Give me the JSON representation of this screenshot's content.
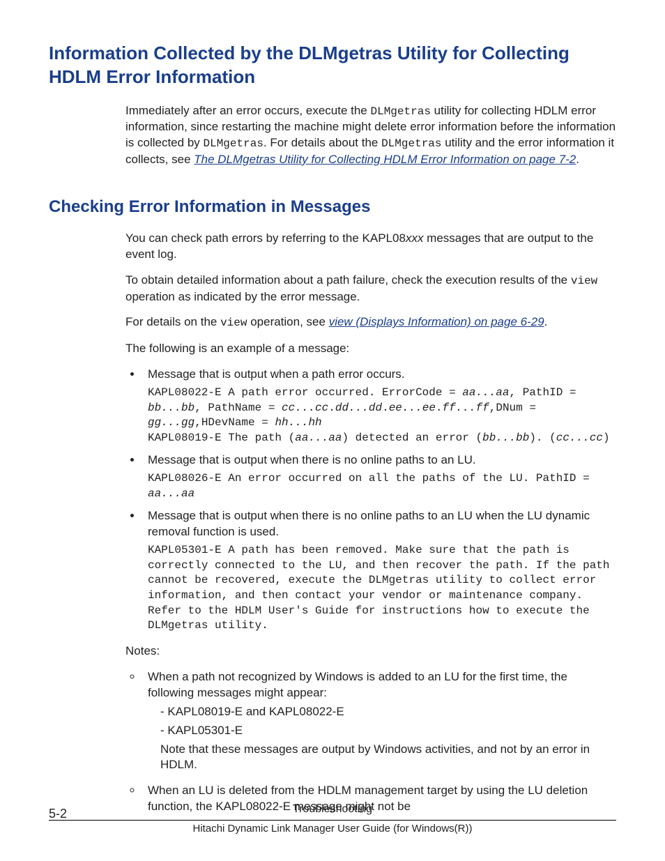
{
  "section1": {
    "heading": "Information Collected by the DLMgetras Utility for Collecting HDLM Error Information",
    "para_a": "Immediately after an error occurs, execute the ",
    "para_b": " utility for collecting HDLM error information, since restarting the machine might delete error information before the information is collected by ",
    "para_c": ". For details about the ",
    "para_d": " utility and the error information it collects, see ",
    "link": "The DLMgetras Utility for Collecting HDLM Error Information on page 7-2",
    "para_e": ".",
    "code": "DLMgetras"
  },
  "section2": {
    "heading": "Checking Error Information in Messages",
    "p1a": "You can check path errors by referring to the KAPL08",
    "p1b": "xxx",
    "p1c": " messages that are output to the event log.",
    "p2a": "To obtain detailed information about a path failure, check the execution results of the ",
    "p2b": "view",
    "p2c": " operation as indicated by the error message.",
    "p3a": "For details on the ",
    "p3b": "view",
    "p3c": " operation, see ",
    "p3link": "view (Displays Information) on page 6-29",
    "p3d": ".",
    "p4": "The following is an example of a message:",
    "items": [
      {
        "label": "Message that is output when a path error occurs.",
        "msg_parts": [
          {
            "t": "plain",
            "v": "KAPL08022-E A path error occurred. ErrorCode = "
          },
          {
            "t": "ital",
            "v": "aa...aa"
          },
          {
            "t": "plain",
            "v": ", PathID = "
          },
          {
            "t": "ital",
            "v": "bb...bb"
          },
          {
            "t": "plain",
            "v": ", PathName = "
          },
          {
            "t": "ital",
            "v": "cc...cc"
          },
          {
            "t": "plain",
            "v": "."
          },
          {
            "t": "ital",
            "v": "dd...dd"
          },
          {
            "t": "plain",
            "v": "."
          },
          {
            "t": "ital",
            "v": "ee...ee"
          },
          {
            "t": "plain",
            "v": "."
          },
          {
            "t": "ital",
            "v": "ff...ff"
          },
          {
            "t": "plain",
            "v": ",DNum = "
          },
          {
            "t": "ital",
            "v": "gg...gg"
          },
          {
            "t": "plain",
            "v": ",HDevName = "
          },
          {
            "t": "ital",
            "v": "hh...hh"
          },
          {
            "t": "br"
          },
          {
            "t": "plain",
            "v": "KAPL08019-E The path ("
          },
          {
            "t": "ital",
            "v": "aa...aa"
          },
          {
            "t": "plain",
            "v": ") detected an error ("
          },
          {
            "t": "ital",
            "v": "bb...bb"
          },
          {
            "t": "plain",
            "v": "). ("
          },
          {
            "t": "ital",
            "v": "cc...cc"
          },
          {
            "t": "plain",
            "v": ")"
          }
        ]
      },
      {
        "label": "Message that is output when there is no online paths to an LU.",
        "msg_parts": [
          {
            "t": "plain",
            "v": "KAPL08026-E An error occurred on all the paths of the LU. PathID = "
          },
          {
            "t": "ital",
            "v": "aa...aa"
          }
        ]
      },
      {
        "label": "Message that is output when there is no online paths to an LU when the LU dynamic removal function is used.",
        "msg_parts": [
          {
            "t": "plain",
            "v": "KAPL05301-E A path has been removed. Make sure that the path is correctly connected to the LU, and then recover the path. If the path cannot be recovered, execute the DLMgetras utility to collect error information, and then contact your vendor or maintenance company."
          },
          {
            "t": "br"
          },
          {
            "t": "plain",
            "v": "Refer to the HDLM User's Guide for instructions how to execute the DLMgetras utility."
          }
        ]
      }
    ],
    "notes_label": "Notes:",
    "notes": [
      {
        "text": "When a path not recognized by Windows is added to an LU for the first time, the following messages might appear:",
        "lines": [
          "- KAPL08019-E and KAPL08022-E",
          "- KAPL05301-E",
          "Note that these messages are output by Windows activities, and not by an error in HDLM."
        ]
      },
      {
        "text": "When an LU is deleted from the HDLM management target by using the LU deletion function, the KAPL08022-E message might not be",
        "lines": []
      }
    ]
  },
  "footer": {
    "page": "5-2",
    "title": "Troubleshooting",
    "sub": "Hitachi Dynamic Link Manager User Guide (for Windows(R))"
  }
}
